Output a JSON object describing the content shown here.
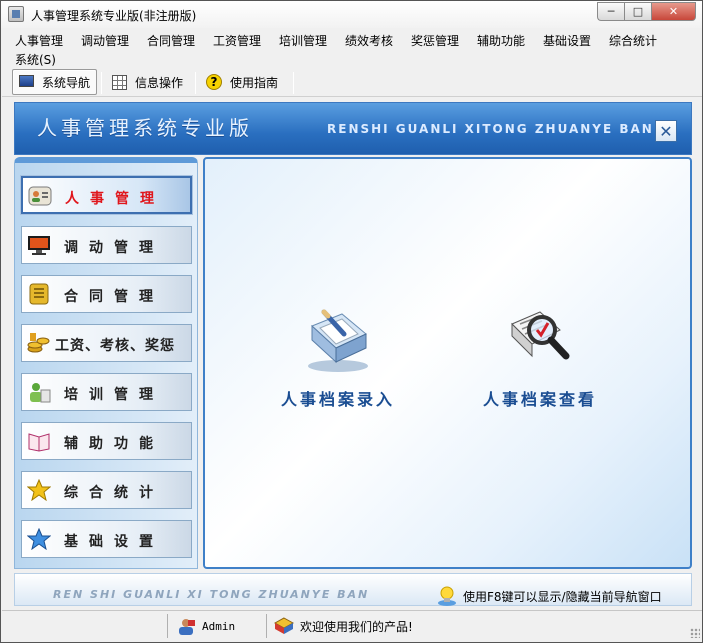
{
  "window": {
    "title": "人事管理系统专业版(非注册版)",
    "min_glyph": "─",
    "max_glyph": "□",
    "close_glyph": "✕"
  },
  "menu": {
    "items": [
      {
        "label": "人事管理"
      },
      {
        "label": "调动管理"
      },
      {
        "label": "合同管理"
      },
      {
        "label": "工资管理"
      },
      {
        "label": "培训管理"
      },
      {
        "label": "绩效考核"
      },
      {
        "label": "奖惩管理"
      },
      {
        "label": "辅助功能"
      },
      {
        "label": "基础设置"
      },
      {
        "label": "综合统计"
      },
      {
        "label": "系统(S)"
      }
    ]
  },
  "toolbar": {
    "nav_label": "系统导航",
    "info_label": "信息操作",
    "guide_label": "使用指南",
    "guide_glyph": "?"
  },
  "banner": {
    "title": "人事管理系统专业版",
    "subtitle": "RENSHI GUANLI XITONG ZHUANYE BAN",
    "close_glyph": "✕"
  },
  "nav": {
    "items": [
      {
        "label": "人事管理",
        "icon": "personnel-icon",
        "active": true
      },
      {
        "label": "调动管理",
        "icon": "monitor-icon",
        "active": false
      },
      {
        "label": "合同管理",
        "icon": "contract-icon",
        "active": false
      },
      {
        "label": "工资、考核、奖惩",
        "icon": "coins-icon",
        "active": false
      },
      {
        "label": "培训管理",
        "icon": "trainee-icon",
        "active": false
      },
      {
        "label": "辅助功能",
        "icon": "book-icon",
        "active": false
      },
      {
        "label": "综合统计",
        "icon": "star-icon",
        "active": false
      },
      {
        "label": "基础设置",
        "icon": "settings-star-icon",
        "active": false
      }
    ]
  },
  "main": {
    "actions": [
      {
        "label": "人事档案录入",
        "icon": "document-pen-icon"
      },
      {
        "label": "人事档案查看",
        "icon": "magnifier-doc-icon"
      }
    ]
  },
  "footer": {
    "pinyin": "REN SHI GUANLI XI TONG ZHUANYE BAN",
    "tip": "使用F8键可以显示/隐藏当前导航窗口"
  },
  "status": {
    "user": "Admin",
    "message": "欢迎使用我们的产品!"
  },
  "colors": {
    "accent": "#2a6fc0",
    "active_nav_text": "#e0161c",
    "action_text": "#1a4d92"
  }
}
